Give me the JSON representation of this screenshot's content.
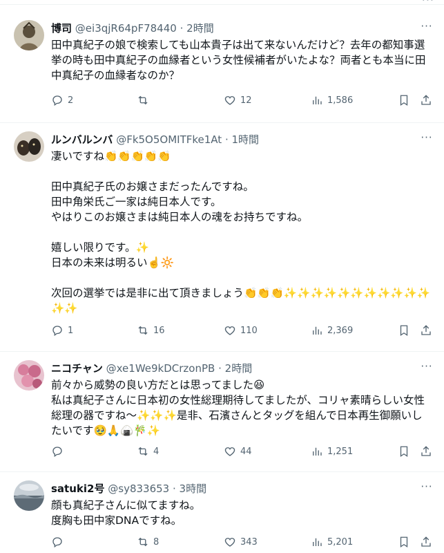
{
  "tweets": [
    {
      "name": "博司",
      "handle": "@ei3qjR64pF78440",
      "dot": "·",
      "time": "2時間",
      "text": "田中真紀子の娘で検索しても山本貴子は出て来ないんだけど？去年の都知事選挙の時も田中真紀子の血縁者という女性候補者がいたよな？両者とも本当に田中真紀子の血縁者なのか？",
      "replies": "2",
      "retweets": "",
      "likes": "12",
      "views": "1,586",
      "avatar_color": "#8a7f6a"
    },
    {
      "name": "ルンバルンバ",
      "handle": "@Fk5O5OMITFke1At",
      "dot": "·",
      "time": "1時間",
      "text": "凄いですね👏👏👏👏👏\n\n田中真紀子氏のお嬢さまだったんですね。\n田中角栄氏ご一家は純日本人です。\nやはりこのお嬢さまは純日本人の魂をお持ちですね。\n\n嬉しい限りです。✨\n日本の未来は明るい☝️🔆\n\n次回の選挙では是非に出て頂きましょう👏👏👏✨✨✨✨✨✨✨✨✨✨✨✨✨",
      "replies": "1",
      "retweets": "16",
      "likes": "110",
      "views": "2,369",
      "avatar_color": "#3d3a36"
    },
    {
      "name": "ニコチャン",
      "handle": "@xe1We9kDCrzonPB",
      "dot": "·",
      "time": "2時間",
      "text": "前々から威勢の良い方だとは思ってました😆\n私は真紀子さんに日本初の女性総理期待してましたが、コリャ素晴らしい女性総理の器ですね〜✨✨✨是非、石濱さんとタッグを組んで日本再生御願いしたいです🥹🙏🍙🎋✨",
      "replies": "",
      "retweets": "4",
      "likes": "44",
      "views": "1,251",
      "avatar_color": "#d9a0b5"
    },
    {
      "name": "satuki2号",
      "handle": "@sy833653",
      "dot": "·",
      "time": "3時間",
      "text": "顔も真紀子さんに似てますね。\n度胸も田中家DNAですね。",
      "replies": "",
      "retweets": "8",
      "likes": "343",
      "views": "5,201",
      "avatar_color": "#6f7f8c"
    }
  ],
  "more_label": "···",
  "icons": [
    "reply-icon",
    "retweet-icon",
    "like-icon",
    "views-icon",
    "bookmark-icon",
    "share-icon",
    "more-icon"
  ]
}
